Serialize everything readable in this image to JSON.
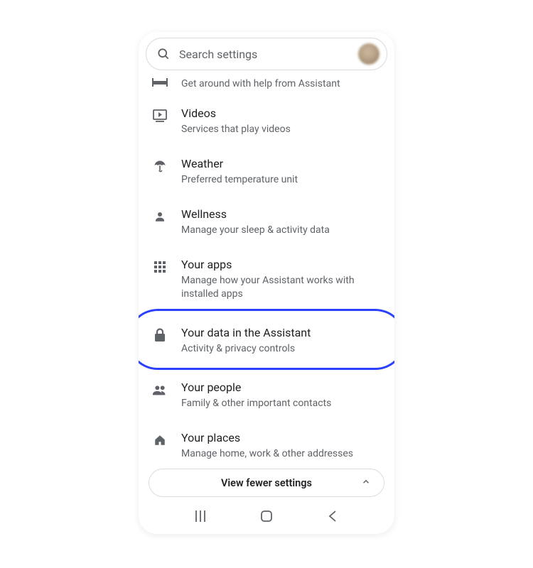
{
  "search": {
    "placeholder": "Search settings"
  },
  "rows": {
    "transport": {
      "sub": "Get around with help from Assistant"
    },
    "videos": {
      "title": "Videos",
      "sub": "Services that play videos"
    },
    "weather": {
      "title": "Weather",
      "sub": "Preferred temperature unit"
    },
    "wellness": {
      "title": "Wellness",
      "sub": "Manage your sleep & activity data"
    },
    "yourapps": {
      "title": "Your apps",
      "sub": "Manage how your Assistant works with installed apps"
    },
    "yourdata": {
      "title": "Your data in the Assistant",
      "sub": "Activity & privacy controls"
    },
    "yourpeople": {
      "title": "Your people",
      "sub": "Family & other important contacts"
    },
    "yourplaces": {
      "title": "Your places",
      "sub": "Manage home, work & other addresses"
    }
  },
  "footer": {
    "viewFewer": "View fewer settings"
  }
}
